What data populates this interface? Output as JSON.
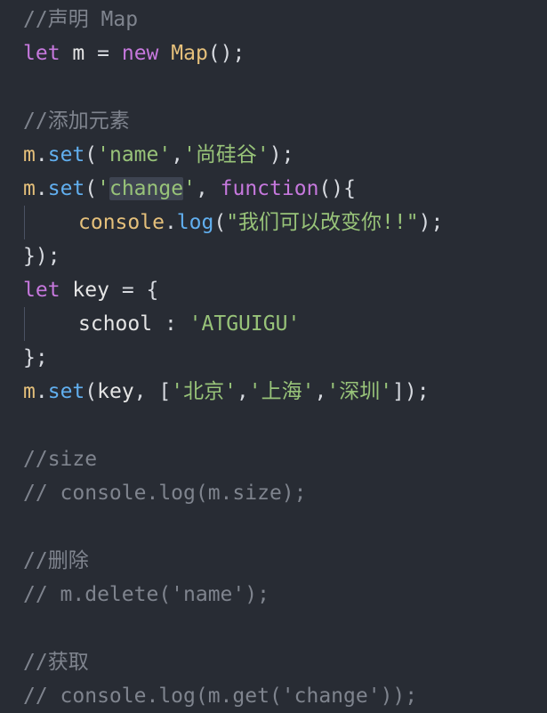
{
  "code": {
    "line1_comment": "//声明 Map",
    "line2_kw": "let",
    "line2_var": "m",
    "line2_eq": "=",
    "line2_new": "new",
    "line2_class": "Map",
    "line2_end": "();",
    "line4_comment": "//添加元素",
    "line5_obj": "m",
    "line5_method": "set",
    "line5_open": "(",
    "line5_str1": "'name'",
    "line5_comma": ",",
    "line5_str2": "'尚硅谷'",
    "line5_end": ");",
    "line6_obj": "m",
    "line6_method": "set",
    "line6_open": "(",
    "line6_str_open": "'",
    "line6_str_word": "change",
    "line6_str_close": "'",
    "line6_comma": ", ",
    "line6_kw": "function",
    "line6_end": "(){",
    "line7_obj": "console",
    "line7_method": "log",
    "line7_open": "(",
    "line7_str": "\"我们可以改变你!!\"",
    "line7_end": ");",
    "line8_text": "});",
    "line9_kw": "let",
    "line9_var": "key",
    "line9_eq": "=",
    "line9_open": "{",
    "line10_prop": "school",
    "line10_colon": ":",
    "line10_str": "'ATGUIGU'",
    "line11_text": "};",
    "line12_obj": "m",
    "line12_method": "set",
    "line12_open": "(",
    "line12_var": "key",
    "line12_mid": ", [",
    "line12_str1": "'北京'",
    "line12_c1": ",",
    "line12_str2": "'上海'",
    "line12_c2": ",",
    "line12_str3": "'深圳'",
    "line12_end": "]);",
    "line14_comment": "//size",
    "line15_comment": "// console.log(m.size);",
    "line17_comment": "//删除",
    "line18_comment": "// m.delete('name');",
    "line20_comment": "//获取",
    "line21_comment": "// console.log(m.get('change'));"
  },
  "colors": {
    "background": "#282c34",
    "keyword": "#c678dd",
    "string": "#98c379",
    "function": "#61afef",
    "class": "#e5c07b",
    "comment": "#7f848e"
  }
}
